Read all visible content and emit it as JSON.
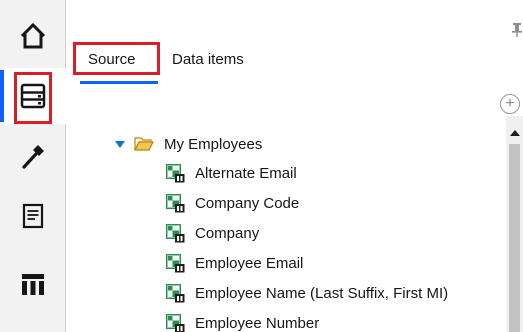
{
  "sidebar": {
    "items": [
      {
        "name": "home",
        "icon": "home-icon"
      },
      {
        "name": "sources",
        "icon": "data-source-icon",
        "active": true
      },
      {
        "name": "build",
        "icon": "hammer-icon"
      },
      {
        "name": "pages",
        "icon": "page-icon"
      },
      {
        "name": "tables",
        "icon": "table-icon"
      }
    ]
  },
  "tabs": [
    {
      "label": "Source",
      "active": true
    },
    {
      "label": "Data items",
      "active": false
    }
  ],
  "tree": {
    "folder": {
      "label": "My Employees",
      "expanded": true
    },
    "items": [
      {
        "label": "Alternate Email"
      },
      {
        "label": "Company Code"
      },
      {
        "label": "Company"
      },
      {
        "label": "Employee Email"
      },
      {
        "label": "Employee Name (Last Suffix, First MI)"
      },
      {
        "label": "Employee Number"
      }
    ]
  },
  "colors": {
    "accent": "#0f62fe",
    "highlight": "#da1e28",
    "caret": "#1474c4",
    "folder": "#f2c94c",
    "item_icon": "#2e8b57"
  }
}
